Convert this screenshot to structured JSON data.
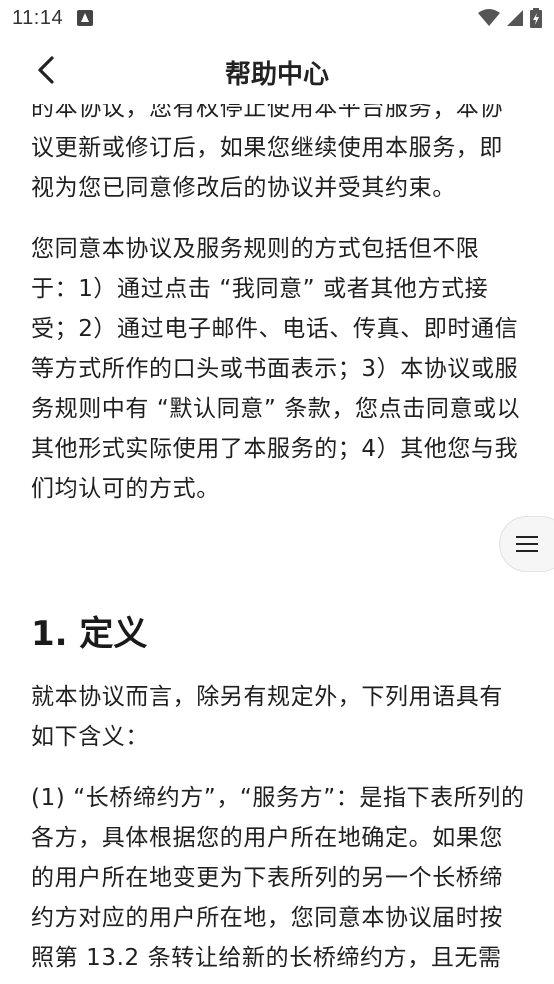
{
  "status_bar": {
    "time": "11:14"
  },
  "header": {
    "title": "帮助中心"
  },
  "content": {
    "paragraphs_top": [
      "的本协议，您有权停止使用本平台服务；本协议更新或修订后，如果您继续使用本服务，即视为您已同意修改后的协议并受其约束。",
      "您同意本协议及服务规则的方式包括但不限于：1）通过点击 “我同意” 或者其他方式接受；2）通过电子邮件、电话、传真、即时通信等方式所作的口头或书面表示；3）本协议或服务规则中有 “默认同意” 条款，您点击同意或以其他形式实际使用了本服务的；4）其他您与我们均认可的方式。"
    ],
    "section_heading": "1. 定义",
    "paragraphs_bottom": [
      "就本协议而言，除另有规定外，下列用语具有如下含义：",
      "(1) “长桥缔约方”，“服务方”：是指下表所列的各方，具体根据您的用户所在地确定。如果您的用户所在地变更为下表所列的另一个长桥缔约方对应的用户所在地，您同意本协议届时按照第 13.2 条转让给新的长桥缔约方，且无需"
    ]
  },
  "icons": {
    "back": "chevron-left-icon",
    "toc": "menu-icon",
    "wifi": "wifi-icon",
    "signal": "signal-icon",
    "battery": "battery-icon",
    "notification": "notification-icon"
  }
}
